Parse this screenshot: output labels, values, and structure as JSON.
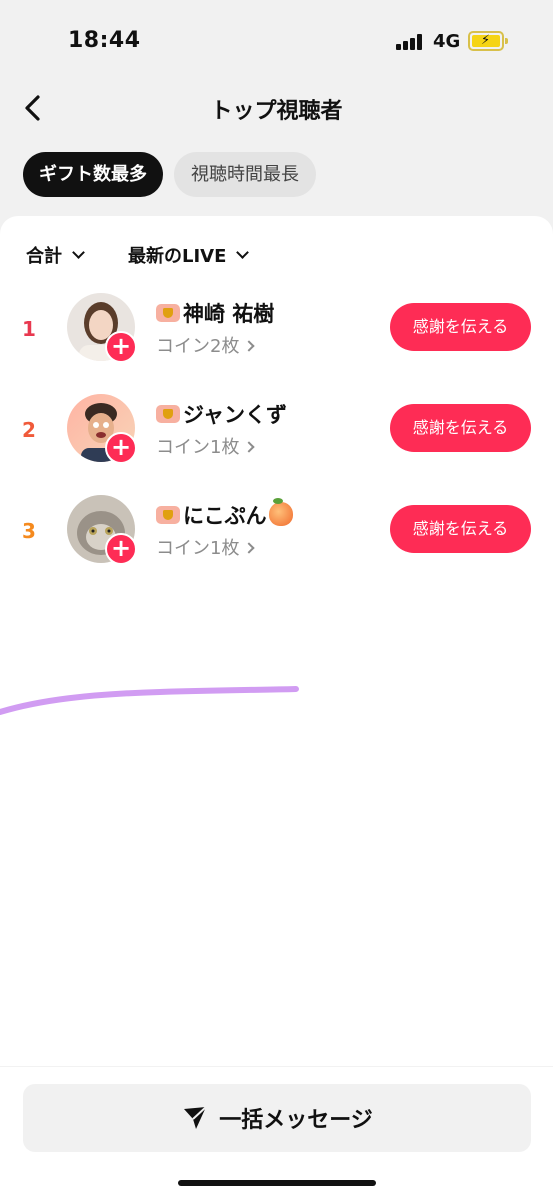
{
  "status_bar": {
    "time": "18:44",
    "network": "4G",
    "battery": "charging-icon"
  },
  "header": {
    "title": "トップ視聴者",
    "back_icon": "chevron-left-icon"
  },
  "tabs": [
    {
      "label": "ギフト数最多",
      "active": true
    },
    {
      "label": "視聴時間最長",
      "active": false
    }
  ],
  "filters": {
    "total": "合計",
    "live": "最新のLIVE"
  },
  "viewers": [
    {
      "rank": "1",
      "name": "神崎 祐樹",
      "coins": "コイン2枚",
      "action": "感謝を伝える",
      "rank_color": "#e8384f"
    },
    {
      "rank": "2",
      "name": "ジャンくず",
      "coins": "コイン1枚",
      "action": "感謝を伝える",
      "rank_color": "#f05a3a"
    },
    {
      "rank": "3",
      "name": "にこぷん",
      "coins": "コイン1枚",
      "action": "感謝を伝える",
      "rank_color": "#f58a1e"
    }
  ],
  "bottom": {
    "broadcast_label": "一括メッセージ"
  },
  "colors": {
    "accent": "#fe2c55",
    "scribble": "#c98bf0"
  }
}
